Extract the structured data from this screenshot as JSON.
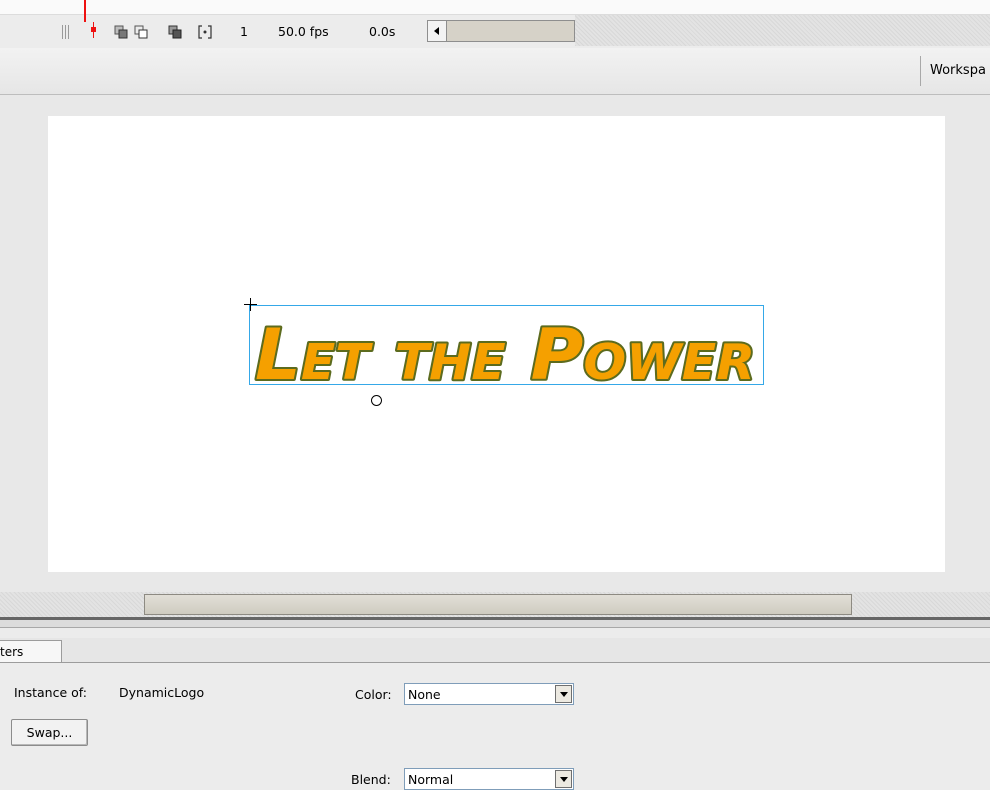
{
  "timeline": {
    "frame": "1",
    "fps": "50.0 fps",
    "elapsed": "0.0s",
    "icons": [
      "onion-skin-icon",
      "onion-skin-outlines-icon",
      "edit-multiple-frames-icon",
      "modify-onion-markers-icon"
    ]
  },
  "editbar": {
    "workspace_label": "Workspa"
  },
  "stage": {
    "logo_text": "Let the Power",
    "logo_fill": "#f5a000",
    "logo_stroke": "#5c6b1e",
    "selection_color": "#35a8e8"
  },
  "properties": {
    "tab_label": "ters",
    "instance_of_label": "Instance of:",
    "instance_of_value": "DynamicLogo",
    "swap_label": "Swap...",
    "color_label": "Color:",
    "color_value": "None",
    "blend_label": "Blend:",
    "blend_value": "Normal"
  }
}
